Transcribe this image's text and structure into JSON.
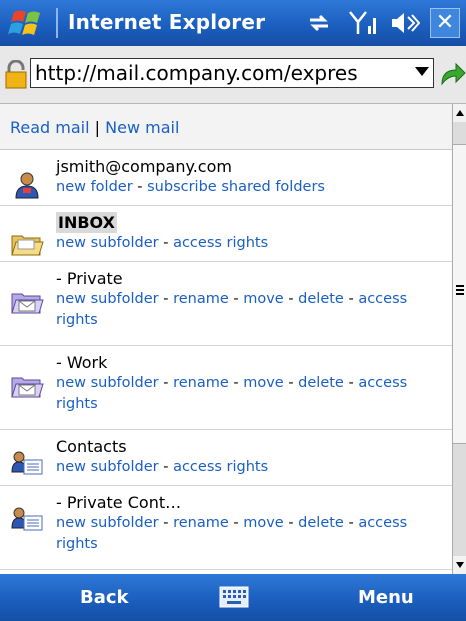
{
  "titlebar": {
    "app_title": "Internet Explorer",
    "close_label": "✕",
    "icons": [
      "windows-logo-icon",
      "connectivity-icon",
      "signal-icon",
      "volume-icon"
    ]
  },
  "address": {
    "url": "http://mail.company.com/expres",
    "icons": [
      "lock-icon",
      "go-icon"
    ]
  },
  "nav": {
    "read_mail": "Read mail",
    "separator": "|",
    "new_mail": "New mail"
  },
  "folders": [
    {
      "name": "jsmith@company.com",
      "icon": "user-icon",
      "selected": false,
      "links": [
        "new folder",
        "subscribe shared folders"
      ]
    },
    {
      "name": "INBOX",
      "icon": "open-folder-icon",
      "selected": true,
      "links": [
        "new subfolder",
        "access rights"
      ]
    },
    {
      "name": "- Private",
      "icon": "mail-folder-icon",
      "selected": false,
      "links": [
        "new subfolder",
        "rename",
        "move",
        "delete",
        "access rights"
      ]
    },
    {
      "name": "- Work",
      "icon": "mail-folder-icon",
      "selected": false,
      "links": [
        "new subfolder",
        "rename",
        "move",
        "delete",
        "access rights"
      ]
    },
    {
      "name": "Contacts",
      "icon": "contacts-icon",
      "selected": false,
      "links": [
        "new subfolder",
        "access rights"
      ]
    },
    {
      "name": "- Private Cont…",
      "icon": "contacts-icon",
      "selected": false,
      "links": [
        "new subfolder",
        "rename",
        "move",
        "delete",
        "access rights"
      ]
    }
  ],
  "softkeys": {
    "left": "Back",
    "right": "Menu",
    "center_icon": "keyboard-icon"
  },
  "colors": {
    "titlebar": "#1b5fbf",
    "link": "#1a5fc4"
  }
}
